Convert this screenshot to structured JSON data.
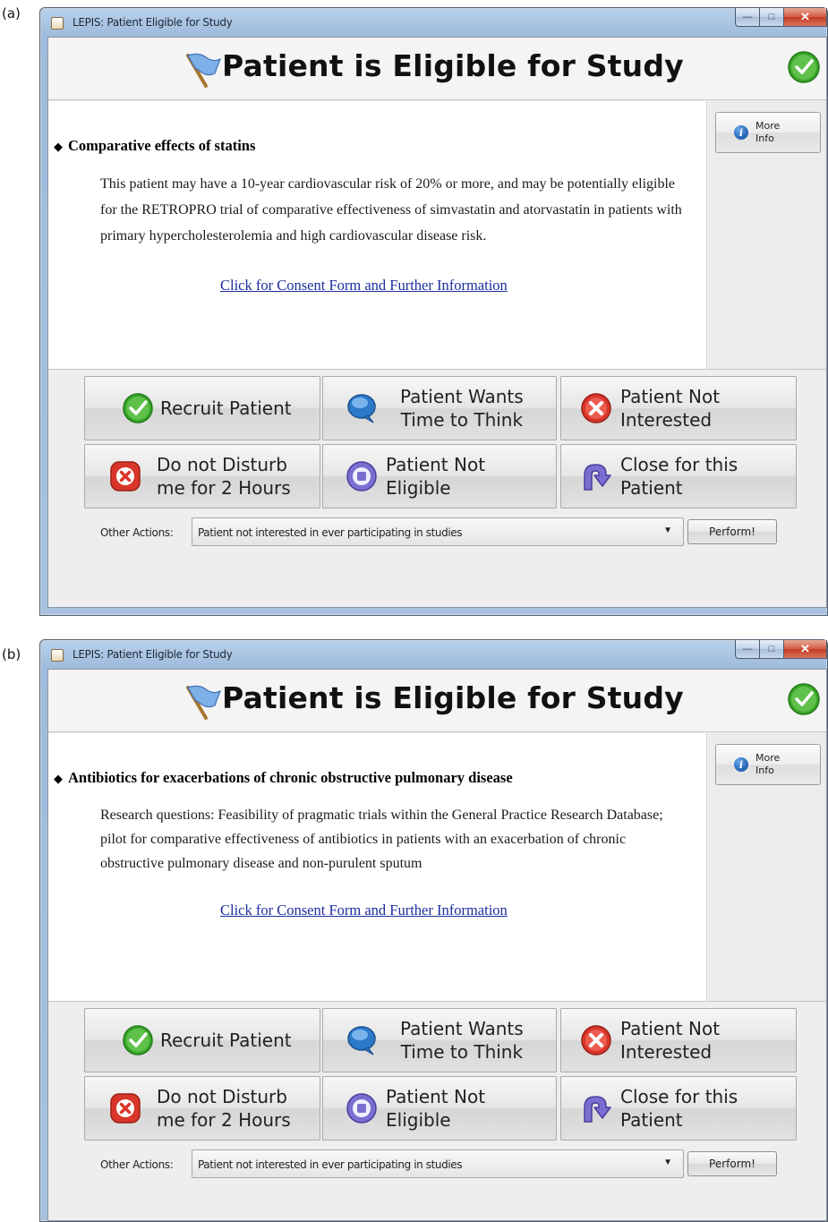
{
  "panels": [
    {
      "label": "(a)",
      "window_title": "LEPIS: Patient Eligible for Study",
      "heading": "Patient is Eligible for Study",
      "more_info": "More Info",
      "study_title": "Comparative effects of statins",
      "study_description": "This patient may have a 10-year cardiovascular risk of 20% or more, and may be potentially eligible for the RETROPRO trial of comparative effectiveness of simvastatin and atorvastatin in patients with primary hypercholesterolemia and high cardiovascular disease risk.",
      "consent_link": "Click for Consent Form and Further Information",
      "buttons": {
        "recruit": "Recruit Patient",
        "time_to_think": "Patient Wants\nTime to Think",
        "not_interested": "Patient Not\nInterested",
        "do_not_disturb": "Do not Disturb\nme for 2 Hours",
        "not_eligible": "Patient Not\nEligible",
        "close": "Close for this\nPatient"
      },
      "other_actions_label": "Other Actions:",
      "other_actions_value": "Patient not interested in ever participating in studies",
      "perform": "Perform!"
    },
    {
      "label": "(b)",
      "window_title": "LEPIS: Patient Eligible for Study",
      "heading": "Patient is Eligible for Study",
      "more_info": "More Info",
      "study_title": "Antibiotics for exacerbations of chronic obstructive pulmonary disease",
      "study_description": "Research questions: Feasibility of pragmatic trials within the General Practice Research Database; pilot for comparative effectiveness of antibiotics in patients with an exacerbation of chronic obstructive pulmonary disease and non-purulent sputum",
      "consent_link": "Click for Consent Form and Further Information",
      "buttons": {
        "recruit": "Recruit Patient",
        "time_to_think": "Patient Wants\nTime to Think",
        "not_interested": "Patient Not\nInterested",
        "do_not_disturb": "Do not Disturb\nme for 2 Hours",
        "not_eligible": "Patient Not\nEligible",
        "close": "Close for this\nPatient"
      },
      "other_actions_label": "Other Actions:",
      "other_actions_value": "Patient not interested in ever participating in studies",
      "perform": "Perform!"
    }
  ],
  "icons": {
    "app": "lepis-app-icon",
    "flag": "flag-icon",
    "eligible": "check-circle-icon",
    "info": "info-icon",
    "recruit": "check-circle-icon",
    "think": "speech-bubble-icon",
    "not_interested": "x-circle-icon",
    "disturb": "x-square-icon",
    "not_eligible": "stop-circle-icon",
    "close": "return-arrow-icon"
  },
  "colors": {
    "titlebar": "#a9c3df",
    "link": "#1d2e9e",
    "green": "#3aa52a",
    "red": "#d8362a",
    "blue": "#2d79c9",
    "purple": "#7a6fd0"
  }
}
